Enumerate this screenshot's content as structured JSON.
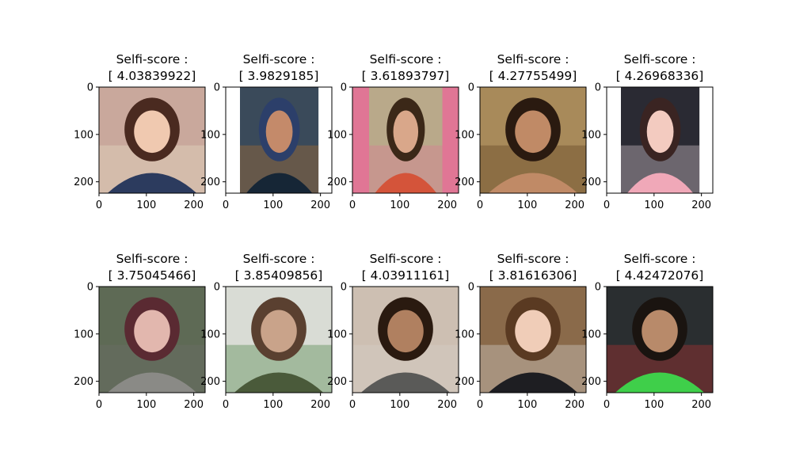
{
  "chart_data": {
    "type": "image_grid",
    "x_ticks": [
      0,
      100,
      200
    ],
    "y_ticks": [
      0,
      100,
      200
    ],
    "x_range": [
      0,
      224
    ],
    "y_range": [
      224,
      0
    ],
    "panels": [
      {
        "title_line1": "Selfi-score :",
        "title_line2": "[ 4.03839922]",
        "score": 4.03839922,
        "photo": {
          "content_x": [
            0,
            224
          ],
          "bg": "#c9a89c",
          "skin": "#f0c9b0",
          "hair": "#4a2a20",
          "shirt": "#2c3b5e",
          "accent": "#e9e2c9"
        }
      },
      {
        "title_line1": "Selfi-score :",
        "title_line2": "[ 3.9829185]",
        "score": 3.9829185,
        "photo": {
          "content_x": [
            30,
            196
          ],
          "bg": "#3a4a5a",
          "skin": "#c48a6a",
          "hair": "#2c3f6a",
          "shirt": "#162636",
          "accent": "#b9732f"
        }
      },
      {
        "title_line1": "Selfi-score :",
        "title_line2": "[ 3.61893797]",
        "score": 3.61893797,
        "photo": {
          "content_x": [
            35,
            190
          ],
          "bg": "#b9a98a",
          "skin": "#d9a78a",
          "hair": "#3b2818",
          "shirt": "#d4543a",
          "accent": "#e07695",
          "side": "#e07695"
        }
      },
      {
        "title_line1": "Selfi-score :",
        "title_line2": "[ 4.27755499]",
        "score": 4.27755499,
        "photo": {
          "content_x": [
            0,
            224
          ],
          "bg": "#a88a5a",
          "skin": "#c08a66",
          "hair": "#2a1a10",
          "shirt": "#c08a66",
          "accent": "#5a3a1e"
        }
      },
      {
        "title_line1": "Selfi-score :",
        "title_line2": "[ 4.26968336]",
        "score": 4.26968336,
        "photo": {
          "content_x": [
            30,
            196
          ],
          "bg": "#2a2a33",
          "skin": "#f3cbc0",
          "hair": "#3a2422",
          "shirt": "#f0a8b8",
          "accent": "#e7d7dc"
        }
      },
      {
        "title_line1": "Selfi-score :",
        "title_line2": "[ 3.75045466]",
        "score": 3.75045466,
        "photo": {
          "content_x": [
            0,
            224
          ],
          "bg": "#5e6a55",
          "skin": "#e2b7ae",
          "hair": "#5a2a32",
          "shirt": "#8a8a86",
          "accent": "#6e6e6a"
        }
      },
      {
        "title_line1": "Selfi-score :",
        "title_line2": "[ 3.85409856]",
        "score": 3.85409856,
        "photo": {
          "content_x": [
            0,
            224
          ],
          "bg": "#d9dcd5",
          "skin": "#c9a38a",
          "hair": "#5a4030",
          "shirt": "#4a5a3a",
          "accent": "#3f7a3a"
        }
      },
      {
        "title_line1": "Selfi-score :",
        "title_line2": "[ 4.03911161]",
        "score": 4.03911161,
        "photo": {
          "content_x": [
            0,
            224
          ],
          "bg": "#cdbfb2",
          "skin": "#b08060",
          "hair": "#2a1a10",
          "shirt": "#5a5a58",
          "accent": "#d8d2c8",
          "side": "#2a0a12"
        }
      },
      {
        "title_line1": "Selfi-score :",
        "title_line2": "[ 3.81616306]",
        "score": 3.81616306,
        "photo": {
          "content_x": [
            0,
            224
          ],
          "bg": "#8a6a4a",
          "skin": "#f0cdb8",
          "hair": "#5a3a22",
          "shirt": "#1e1e22",
          "accent": "#dcdcdc"
        }
      },
      {
        "title_line1": "Selfi-score :",
        "title_line2": "[ 4.42472076]",
        "score": 4.42472076,
        "photo": {
          "content_x": [
            0,
            224
          ],
          "bg": "#2a2e30",
          "skin": "#b88a6a",
          "hair": "#1a1410",
          "shirt": "#3fcf4a",
          "accent": "#c23030"
        }
      }
    ]
  }
}
